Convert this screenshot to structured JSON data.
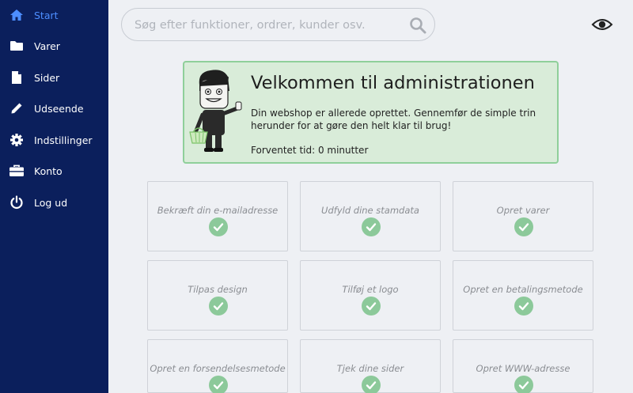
{
  "sidebar": {
    "items": [
      {
        "label": "Start",
        "icon": "home-icon",
        "active": true
      },
      {
        "label": "Varer",
        "icon": "folder-icon"
      },
      {
        "label": "Sider",
        "icon": "file-icon"
      },
      {
        "label": "Udseende",
        "icon": "pencil-icon"
      },
      {
        "label": "Indstillinger",
        "icon": "gear-icon"
      },
      {
        "label": "Konto",
        "icon": "briefcase-icon"
      },
      {
        "label": "Log ud",
        "icon": "power-icon"
      }
    ]
  },
  "search": {
    "placeholder": "Søg efter funktioner, ordrer, kunder osv.",
    "value": ""
  },
  "welcome": {
    "title": "Velkommen til administrationen",
    "description": "Din webshop er allerede oprettet. Gennemfør de simple trin herunder for at gøre den helt klar til brug!",
    "time": "Forventet tid: 0 minutter"
  },
  "tasks": [
    {
      "label": "Bekræft din e-mailadresse",
      "done": true
    },
    {
      "label": "Udfyld dine stamdata",
      "done": true
    },
    {
      "label": "Opret varer",
      "done": true
    },
    {
      "label": "Tilpas design",
      "done": true
    },
    {
      "label": "Tilføj et logo",
      "done": true
    },
    {
      "label": "Opret en betalingsmetode",
      "done": true
    },
    {
      "label": "Opret en forsendelsesmetode",
      "done": true
    },
    {
      "label": "Tjek dine sider",
      "done": true
    },
    {
      "label": "Opret WWW-adresse",
      "done": true
    }
  ],
  "colors": {
    "sidebar": "#0b1f5c",
    "accent": "#4d8eff",
    "success": "#8cc99a",
    "welcome_bg": "#d9ecd9"
  }
}
